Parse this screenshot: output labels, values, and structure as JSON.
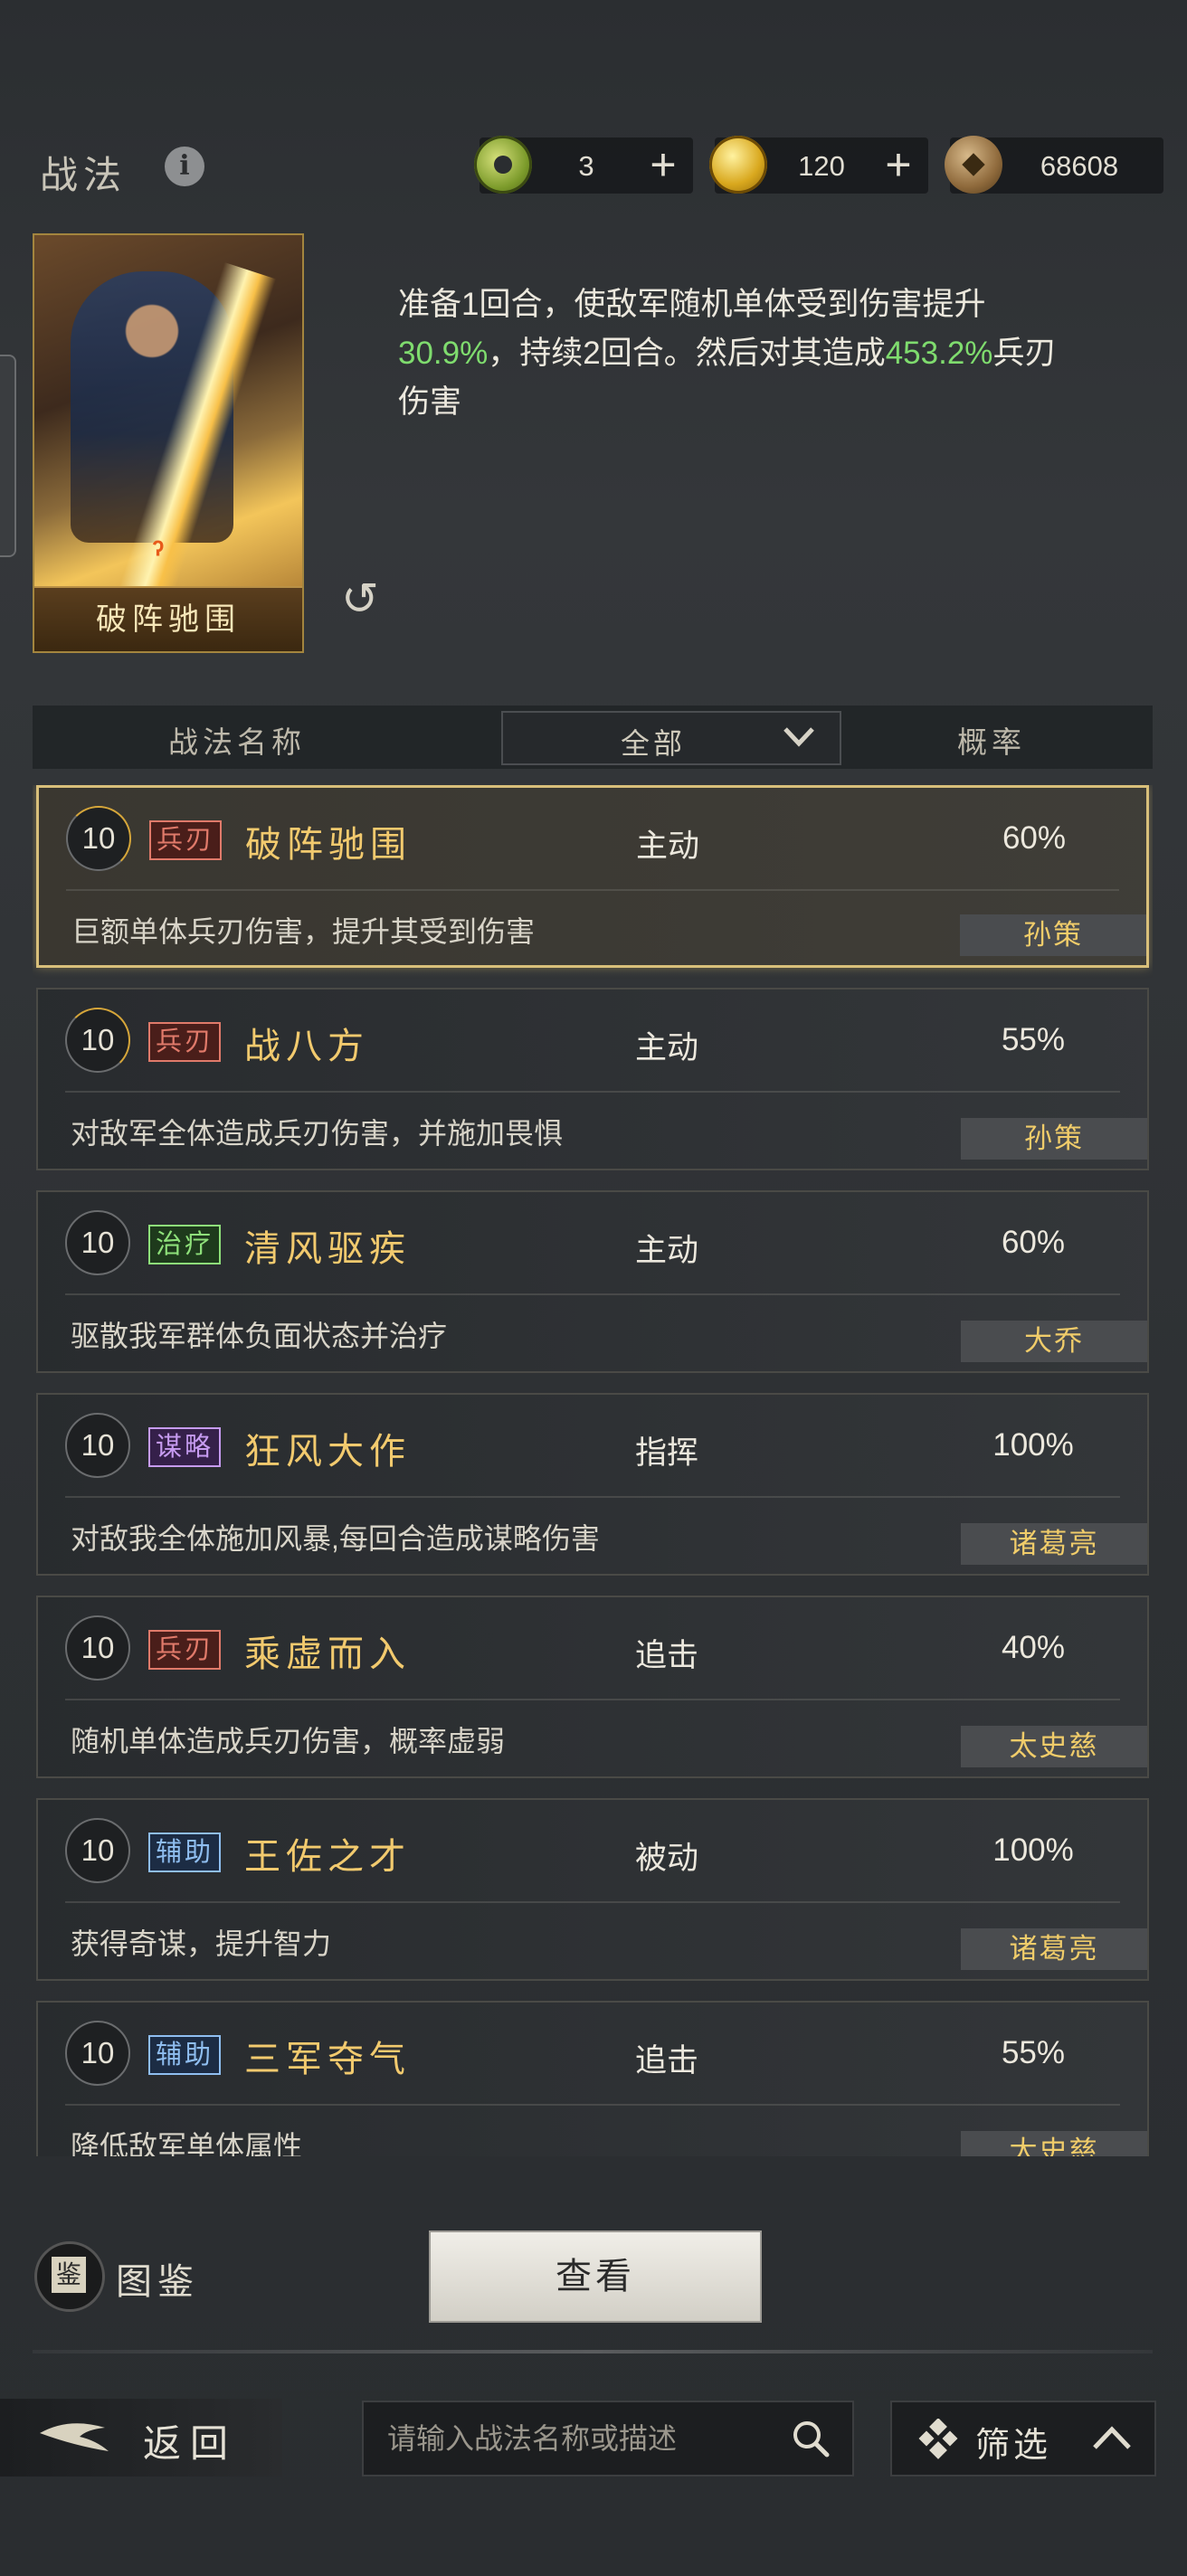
{
  "header": {
    "title": "战法",
    "currencies": [
      {
        "icon": "jade-coin-icon",
        "value": "3"
      },
      {
        "icon": "gold-coin-icon",
        "value": "120"
      },
      {
        "icon": "copper-coin-icon",
        "value": "68608"
      }
    ]
  },
  "selected": {
    "card_name": "破阵驰围",
    "description": [
      {
        "text": "准备1回合，使敌军随机单体受到伤害提升"
      },
      {
        "text": "30.9%",
        "highlight": true
      },
      {
        "text": "，持续2回合。然后对其造成"
      },
      {
        "text": "453.2%",
        "highlight": true
      },
      {
        "text": "兵刃伤害"
      }
    ]
  },
  "table_header": {
    "name": "战法名称",
    "filter": "全部",
    "rate": "概率"
  },
  "colors": {
    "highlight": "#7fdc6e",
    "skill_name": "#f2ca6e",
    "general_name": "#f0cc6a",
    "selected_border": "#d8bf7a"
  },
  "skills": [
    {
      "level": "10",
      "tag": "兵刃",
      "tag_type": "blade",
      "name": "破阵驰围",
      "type": "主动",
      "rate": "60%",
      "desc": "巨额单体兵刃伤害，提升其受到伤害",
      "general": "孙策",
      "selected": true
    },
    {
      "level": "10",
      "tag": "兵刃",
      "tag_type": "blade",
      "name": "战八方",
      "type": "主动",
      "rate": "55%",
      "desc": "对敌军全体造成兵刃伤害，并施加畏惧",
      "general": "孙策"
    },
    {
      "level": "10",
      "tag": "治疗",
      "tag_type": "heal",
      "name": "清风驱疾",
      "type": "主动",
      "rate": "60%",
      "desc": "驱散我军群体负面状态并治疗",
      "general": "大乔"
    },
    {
      "level": "10",
      "tag": "谋略",
      "tag_type": "strat",
      "name": "狂风大作",
      "type": "指挥",
      "rate": "100%",
      "desc": "对敌我全体施加风暴,每回合造成谋略伤害",
      "general": "诸葛亮"
    },
    {
      "level": "10",
      "tag": "兵刃",
      "tag_type": "blade",
      "name": "乘虚而入",
      "type": "追击",
      "rate": "40%",
      "desc": "随机单体造成兵刃伤害，概率虚弱",
      "general": "太史慈"
    },
    {
      "level": "10",
      "tag": "辅助",
      "tag_type": "aux",
      "name": "王佐之才",
      "type": "被动",
      "rate": "100%",
      "desc": "获得奇谋，提升智力",
      "general": "诸葛亮"
    },
    {
      "level": "10",
      "tag": "辅助",
      "tag_type": "aux",
      "name": "三军夺气",
      "type": "追击",
      "rate": "55%",
      "desc": "降低敌军单体属性",
      "general": "太史慈"
    }
  ],
  "bottom": {
    "atlas_label": "图鉴",
    "view_button": "查看",
    "back_label": "返回",
    "search_placeholder": "请输入战法名称或描述",
    "filter_label": "筛选"
  }
}
